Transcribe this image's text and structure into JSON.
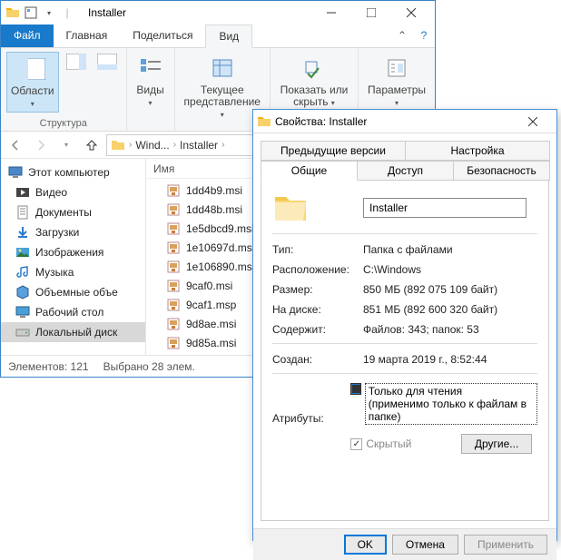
{
  "explorer": {
    "window_title": "Installer",
    "tabs": {
      "file": "Файл",
      "home": "Главная",
      "share": "Поделиться",
      "view": "Вид"
    },
    "ribbon": {
      "group1_name": "Структура",
      "panes": "Области",
      "views": "Виды",
      "current": "Текущее представление",
      "showhide": "Показать или скрыть",
      "options": "Параметры"
    },
    "breadcrumb": {
      "seg1": "Wind...",
      "seg2": "Installer"
    },
    "tree": {
      "this_pc": "Этот компьютер",
      "videos": "Видео",
      "documents": "Документы",
      "downloads": "Загрузки",
      "pictures": "Изображения",
      "music": "Музыка",
      "volumes": "Объемные объе",
      "desktop": "Рабочий стол",
      "localdisk": "Локальный диск"
    },
    "files": {
      "col_name": "Имя",
      "items": [
        "1dd4b9.msi",
        "1dd48b.msi",
        "1e5dbcd9.msi",
        "1e10697d.msi",
        "1e106890.msi",
        "9caf0.msi",
        "9caf1.msp",
        "9d8ae.msi",
        "9d85a.msi"
      ]
    },
    "status": {
      "elements": "Элементов: 121",
      "selected": "Выбрано 28 элем."
    }
  },
  "props": {
    "title": "Свойства: Installer",
    "tabs": {
      "prev_versions": "Предыдущие версии",
      "customize": "Настройка",
      "general": "Общие",
      "sharing": "Доступ",
      "security": "Безопасность"
    },
    "name_value": "Installer",
    "rows": {
      "type_label": "Тип:",
      "type_value": "Папка с файлами",
      "location_label": "Расположение:",
      "location_value": "C:\\Windows",
      "size_label": "Размер:",
      "size_value": "850 МБ (892 075 109 байт)",
      "ondisk_label": "На диске:",
      "ondisk_value": "851 МБ (892 600 320 байт)",
      "contains_label": "Содержит:",
      "contains_value": "Файлов: 343; папок: 53",
      "created_label": "Создан:",
      "created_value": "19 марта 2019 г., 8:52:44",
      "attrs_label": "Атрибуты:",
      "readonly": "Только для чтения",
      "readonly_note": "(применимо только к файлам в папке)",
      "hidden": "Скрытый",
      "other": "Другие..."
    },
    "buttons": {
      "ok": "OK",
      "cancel": "Отмена",
      "apply": "Применить"
    }
  }
}
